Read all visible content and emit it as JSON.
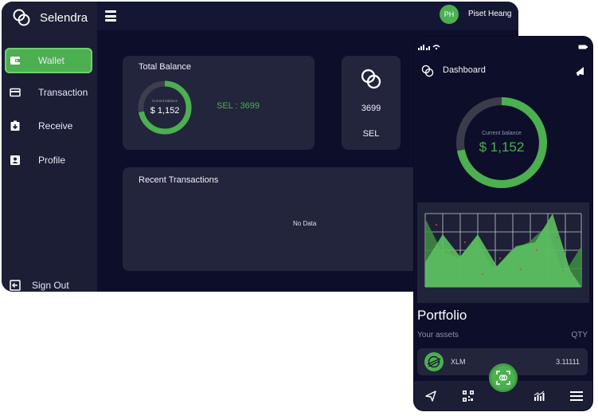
{
  "brand": {
    "name": "Selendra",
    "accent": "#4caf50"
  },
  "user": {
    "initials": "PH",
    "name": "Piset Heang"
  },
  "sidebar": {
    "items": [
      {
        "label": "Wallet",
        "icon": "wallet-icon",
        "active": true
      },
      {
        "label": "Transaction",
        "icon": "card-icon",
        "active": false
      },
      {
        "label": "Receive",
        "icon": "receive-icon",
        "active": false
      },
      {
        "label": "Profile",
        "icon": "profile-icon",
        "active": false
      }
    ],
    "sign_out": "Sign Out"
  },
  "balance_card": {
    "title": "Total Balance",
    "ring_caption": "Current balance",
    "ring_value": "$ 1,152",
    "ring_fraction": 0.72,
    "sel_amount": "SEL : 3699"
  },
  "token_card": {
    "amount": "3699",
    "symbol": "SEL"
  },
  "transactions": {
    "title": "Recent Transactions",
    "empty": "No Data"
  },
  "phone": {
    "title": "Dashboard",
    "ring_caption": "Current balance",
    "ring_value": "$ 1,152",
    "ring_fraction": 0.72,
    "portfolio_title": "Portfolio",
    "assets_label": "Your assets",
    "qty_label": "QTY",
    "assets": [
      {
        "name": "XLM",
        "qty": "3.11111"
      }
    ]
  }
}
